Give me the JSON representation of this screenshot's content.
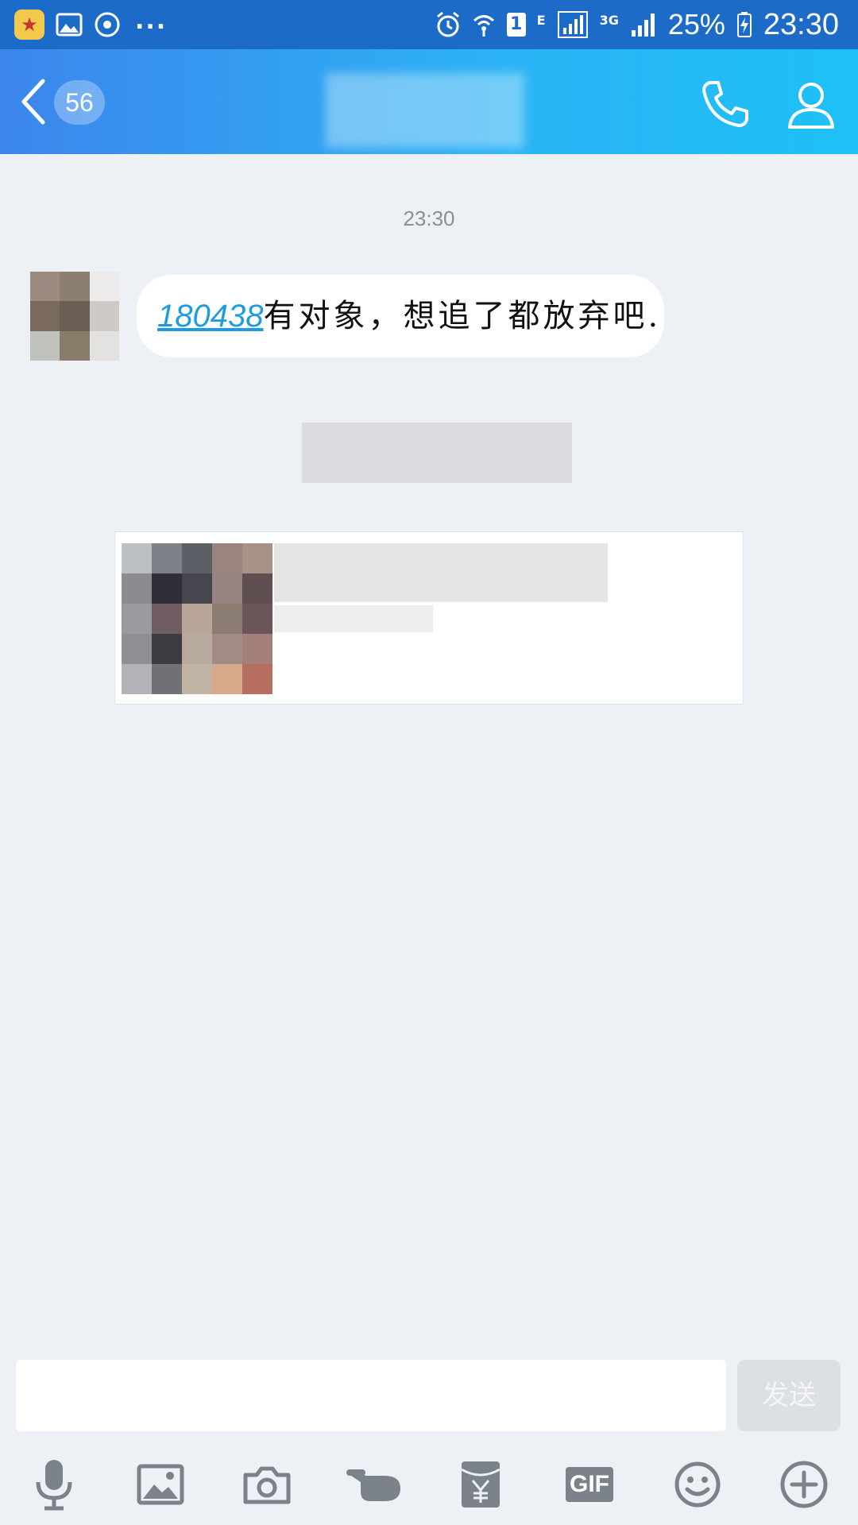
{
  "status_bar": {
    "icons_left": [
      "qq-app-icon",
      "gallery-icon",
      "assistant-icon"
    ],
    "more": "...",
    "sim_slot": "1",
    "network_e": "E",
    "network_3g": "3G",
    "battery": "25%",
    "time": "23:30"
  },
  "header": {
    "unread_count": "56"
  },
  "chat": {
    "timestamp": "23:30",
    "message": {
      "link": "180438",
      "text": "有对象，想追了都放弃吧."
    }
  },
  "input": {
    "value": "",
    "send_label": "发送"
  },
  "toolbar": {
    "gif_label": "GIF",
    "items": [
      "microphone-icon",
      "image-icon",
      "camera-icon",
      "poke-icon",
      "red-packet-icon",
      "gif-icon",
      "emoji-icon",
      "plus-icon"
    ]
  },
  "colors": {
    "status_bar": "#1d6bc8",
    "header_start": "#3c86ec",
    "header_end": "#1ec0f7",
    "link": "#1e9ce0",
    "background": "#edf1f5"
  }
}
